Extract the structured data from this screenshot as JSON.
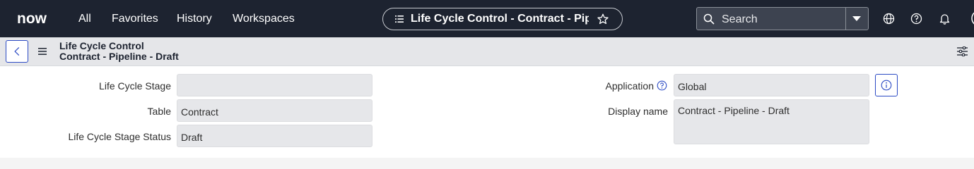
{
  "nav": {
    "logo_text": "now",
    "menu": [
      "All",
      "Favorites",
      "History",
      "Workspaces"
    ],
    "context_pill": "Life Cycle Control - Contract - Pip...",
    "search_placeholder": "Search",
    "icons": [
      "globe-icon",
      "help-icon",
      "bell-icon"
    ]
  },
  "form_header": {
    "title_line1": "Life Cycle Control",
    "title_line2": "Contract - Pipeline - Draft"
  },
  "form": {
    "left": [
      {
        "label": "Life Cycle Stage",
        "value": ""
      },
      {
        "label": "Table",
        "value": "Contract"
      },
      {
        "label": "Life Cycle Stage Status",
        "value": "Draft"
      }
    ],
    "right": [
      {
        "label": "Application",
        "value": "Global"
      },
      {
        "label": "Display name",
        "value": "Contract - Pipeline - Draft"
      }
    ]
  },
  "colors": {
    "nav_bg": "#1d2330",
    "accent": "#2b4ac4",
    "logo_green": "#62d84e",
    "field_bg": "#e6e7ea"
  }
}
